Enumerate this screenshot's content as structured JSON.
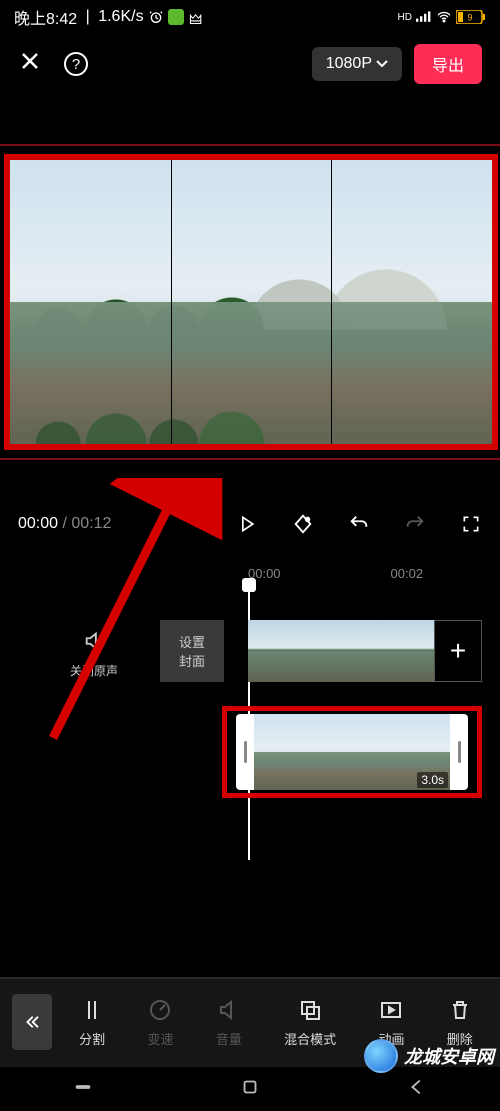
{
  "status": {
    "time": "晚上8:42",
    "speed": "1.6K/s",
    "hd": "HD",
    "battery": "9"
  },
  "topbar": {
    "resolution": "1080P",
    "export": "导出"
  },
  "playback": {
    "current": "00:00",
    "duration": "00:12"
  },
  "ruler": {
    "t0": "00:00",
    "t1": "00:02"
  },
  "tracks": {
    "mute_label": "关闭原声",
    "cover_l1": "设置",
    "cover_l2": "封面",
    "clip_dur": "3.0s"
  },
  "toolbar": {
    "split": "分割",
    "speed": "变速",
    "volume": "音量",
    "blend": "混合模式",
    "anim": "动画",
    "delete": "删除"
  },
  "watermark": "龙城安卓网"
}
